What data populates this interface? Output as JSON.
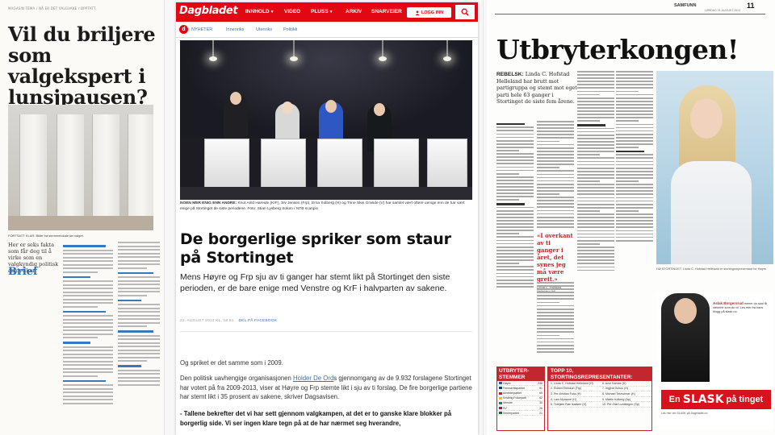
{
  "left_page": {
    "header": "MAGASIN TEMA / NÅ ER DET VALGVAKE / OPPTATT",
    "headline": "Vil du briljere som valgekspert i lunsjpausen?",
    "photo_caption": "FORTSATT KLAR: Bilde fra stemmelokale før valget.",
    "intro": "Her er seks fakta som får deg til å virke som en valgkyndig politisk analytiker.",
    "brief_label": "Brief"
  },
  "dagbladet": {
    "logo": "Dagbladet",
    "nav": {
      "innhold": "INNHOLD",
      "video": "VIDEO",
      "pluss": "PLUSS",
      "arkiv": "ARKIV",
      "snarveier": "SNARVEIER"
    },
    "login_label": "LOGG INN",
    "subnav": [
      "NYHETER",
      "Innenriks",
      "Utenriks",
      "Politikk"
    ],
    "photo_caption_label": "NOEN MER ENIG ENN ANDRE:",
    "photo_caption_text": "Knut Arild Hareide (KrF), Siv Jensen (Frp), Erna Solberg (H) og Trine Skei Grande (V) har samlet vært oftere uenige enn de har vært enige på Stortinget de siste periodene. Foto: Stian Lysberg Solum / NTB scanpix",
    "title": "De borgerlige spriker som staur på Stortinget",
    "lead": "Mens Høyre og Frp sju av ti ganger har stemt likt på Stortinget den siste perioden, er de bare enige med Venstre og KrF i halvparten av sakene.",
    "meta": "22. AUGUST 2013 KL. 18:51",
    "share": "DEL PÅ FACEBOOK",
    "p1": "Og spriket er det samme som i 2009.",
    "p2_before": "Den politisk uavhengige organisasjonen ",
    "p2_link": "Holder De Ord",
    "p2_after": "s gjennomgang av de 9.932 forslagene Stortinget har votert på fra 2009-2013, viser at Høyre og Frp stemte likt i sju av ti forslag. De fire borgerlige partiene har stemt likt i 35 prosent av sakene, skriver Dagsavisen.",
    "p3": "- Tallene bekrefter det vi har sett gjennom valgkampen, at det er to ganske klare blokker på borgerlig side. Vi ser ingen klare tegn på at de har nærmet seg hverandre,"
  },
  "right_page": {
    "section": "SAMFUNN",
    "page_number": "11",
    "date": "LØRDAG 31.AUGUST 2013",
    "headline": "Utbryterkongen!",
    "lead_label": "REBELSK:",
    "lead_text": "Linda C. Hofstad Helleland har brutt mot partigruppa og stemt mot eget parti hele 63 ganger i Stortinget de siste fem årene.",
    "quote": "«I overkant av ti ganger i året, det synes jeg må være greit.»",
    "quote_author": "Linda C. Hofstad Helleland (H)",
    "photo_caption": "HØ STORTINGET: Linda C. Hofstad Helleland er stortingsrepresentant for Høyre.",
    "stemmer_box": {
      "title": "UTBRYTER-STEMMER",
      "rows": [
        {
          "party": "Høyre",
          "value": "248",
          "color": "#1f5fa8"
        },
        {
          "party": "Fremskrittspartiet",
          "value": "91",
          "color": "#1a3a78"
        },
        {
          "party": "Arbeiderpartiet",
          "value": "65",
          "color": "#d7121d"
        },
        {
          "party": "Kristelig Folkeparti",
          "value": "62",
          "color": "#f2c200"
        },
        {
          "party": "Venstre",
          "value": "30",
          "color": "#0f8a4f"
        },
        {
          "party": "SV",
          "value": "26",
          "color": "#b40f55"
        },
        {
          "party": "Senterpartiet",
          "value": "21",
          "color": "#0a6b3a"
        }
      ]
    },
    "top_box": {
      "title": "TOPP 10, STORTINGSREPRESENTANTER:",
      "rows": [
        "1. Linda C. Hofstad Helleland (H)",
        "2. Robert Eriksson (Frp)",
        "3. Per-Kristian Foss (H)",
        "4. Lars Myraune (H)",
        "5. Torbjørn Røe Isaksen (H)",
        "6. Arve Kambe (H)",
        "7. Ingjerd Schou (H)",
        "8. Michael Tetzschner (H)",
        "9. Martin Kolberg (Ap)",
        "10. Per-Olaf Lundteigen (Sp)"
      ]
    },
    "promo_text_label": "Aslak Borgersrud",
    "promo_text": "mener du skal få stemme som du vil. Les mer fra hans blogg på slask.no",
    "banner_pre": "En",
    "banner_main": "SLASK",
    "banner_post": "på tinget",
    "footnote": "Les mer om SLASK på Dagbladet.no"
  }
}
